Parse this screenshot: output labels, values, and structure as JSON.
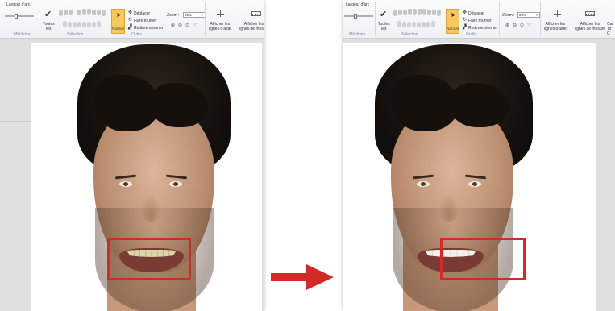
{
  "ribbon": {
    "arch_width_label": "Largeur d'arc",
    "all_button_label": "Toutes\nles",
    "normal_button_label": "Normal",
    "tools": {
      "move": "Déplacer",
      "rotate": "Faire tourner",
      "resize": "Redimensionner"
    },
    "zoom_label": "Zoom :",
    "zoom_value": "90%",
    "show_guides_label": "Afficher les\nlignes d'aide",
    "show_measure_label": "Afficher les\nlignes de mesure",
    "groups": {
      "jaw": "Mâchoire",
      "selection": "Sélection",
      "tools": "Outils",
      "display": "Affichage"
    }
  },
  "right_panel_extra": {
    "cut_label": "Car\nTo\nC"
  },
  "icons": [
    "checkmark-icon",
    "cursor-arrow-icon",
    "move-icon",
    "rotate-icon",
    "resize-icon",
    "zoom-in-icon",
    "zoom-out-icon",
    "fit-icon",
    "guide-lines-icon",
    "ruler-icon",
    "red-arrow-icon"
  ],
  "colors": {
    "normal_button": "#f7c860",
    "highlight_box": "#d22b27",
    "arrow": "#d22b27"
  }
}
